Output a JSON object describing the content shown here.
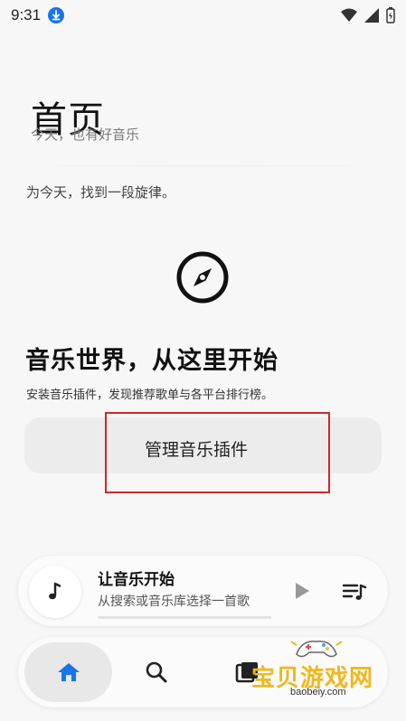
{
  "status_bar": {
    "time": "9:31"
  },
  "header": {
    "title": "首页",
    "subtitle": "今天，也有好音乐",
    "tagline": "为今天，找到一段旋律。"
  },
  "hero": {
    "icon": "compass-icon",
    "title": "音乐世界，从这里开始",
    "description": "安装音乐插件，发现推荐歌单与各平台排行榜。",
    "button_label": "管理音乐插件"
  },
  "player": {
    "title": "让音乐开始",
    "subtitle": "从搜索或音乐库选择一首歌",
    "art_icon": "music-note-icon",
    "play_icon": "play-icon",
    "queue_icon": "queue-icon",
    "progress": 0
  },
  "nav": {
    "items": [
      {
        "name": "home",
        "icon": "home-icon",
        "active": true
      },
      {
        "name": "search",
        "icon": "search-icon",
        "active": false
      },
      {
        "name": "library",
        "icon": "library-icon",
        "active": false
      }
    ]
  },
  "watermark": {
    "text": "宝贝游戏网",
    "url": "baobeiy.com"
  },
  "colors": {
    "accent": "#1a73e8",
    "background": "#f7f7f7",
    "highlight": "#cc2a2a",
    "watermark": "#f0b81e"
  }
}
